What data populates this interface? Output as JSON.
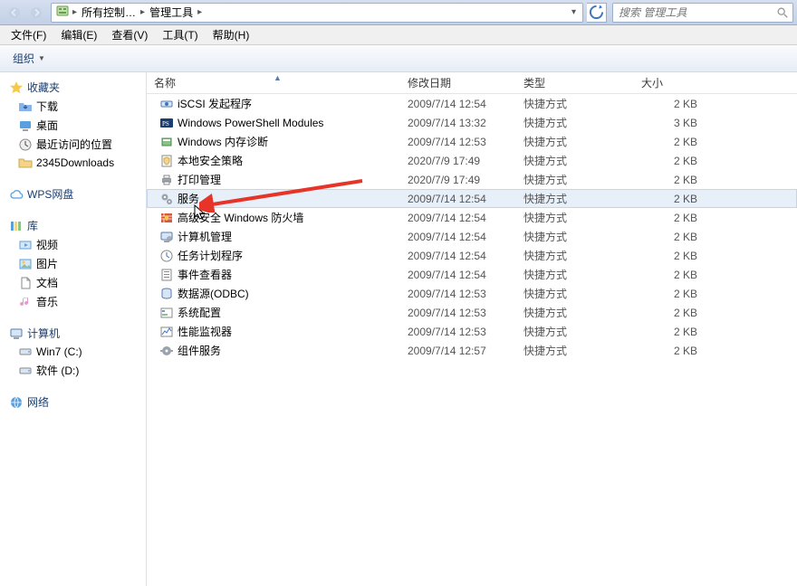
{
  "nav": {
    "breadcrumb": [
      "所有控制…",
      "管理工具"
    ],
    "search_placeholder": "搜索 管理工具"
  },
  "menu": {
    "file": "文件(F)",
    "edit": "编辑(E)",
    "view": "查看(V)",
    "tools": "工具(T)",
    "help": "帮助(H)"
  },
  "toolbar": {
    "organize": "组织"
  },
  "sidebar": {
    "favorites": {
      "title": "收藏夹",
      "items": [
        "下载",
        "桌面",
        "最近访问的位置",
        "2345Downloads"
      ]
    },
    "wps": {
      "title": "WPS网盘"
    },
    "libraries": {
      "title": "库",
      "items": [
        "视频",
        "图片",
        "文档",
        "音乐"
      ]
    },
    "computer": {
      "title": "计算机",
      "items": [
        "Win7 (C:)",
        "软件 (D:)"
      ]
    },
    "network": {
      "title": "网络"
    }
  },
  "columns": {
    "name": "名称",
    "date": "修改日期",
    "type": "类型",
    "size": "大小"
  },
  "files": [
    {
      "name": "iSCSI 发起程序",
      "date": "2009/7/14 12:54",
      "type": "快捷方式",
      "size": "2 KB",
      "icon": "iscsi"
    },
    {
      "name": "Windows PowerShell Modules",
      "date": "2009/7/14 13:32",
      "type": "快捷方式",
      "size": "3 KB",
      "icon": "ps"
    },
    {
      "name": "Windows 内存诊断",
      "date": "2009/7/14 12:53",
      "type": "快捷方式",
      "size": "2 KB",
      "icon": "mem"
    },
    {
      "name": "本地安全策略",
      "date": "2020/7/9 17:49",
      "type": "快捷方式",
      "size": "2 KB",
      "icon": "secpol"
    },
    {
      "name": "打印管理",
      "date": "2020/7/9 17:49",
      "type": "快捷方式",
      "size": "2 KB",
      "icon": "print"
    },
    {
      "name": "服务",
      "date": "2009/7/14 12:54",
      "type": "快捷方式",
      "size": "2 KB",
      "icon": "services",
      "selected": true
    },
    {
      "name": "高级安全 Windows 防火墙",
      "date": "2009/7/14 12:54",
      "type": "快捷方式",
      "size": "2 KB",
      "icon": "firewall"
    },
    {
      "name": "计算机管理",
      "date": "2009/7/14 12:54",
      "type": "快捷方式",
      "size": "2 KB",
      "icon": "compmgmt"
    },
    {
      "name": "任务计划程序",
      "date": "2009/7/14 12:54",
      "type": "快捷方式",
      "size": "2 KB",
      "icon": "tasksched"
    },
    {
      "name": "事件查看器",
      "date": "2009/7/14 12:54",
      "type": "快捷方式",
      "size": "2 KB",
      "icon": "eventvwr"
    },
    {
      "name": "数据源(ODBC)",
      "date": "2009/7/14 12:53",
      "type": "快捷方式",
      "size": "2 KB",
      "icon": "odbc"
    },
    {
      "name": "系统配置",
      "date": "2009/7/14 12:53",
      "type": "快捷方式",
      "size": "2 KB",
      "icon": "msconfig"
    },
    {
      "name": "性能监视器",
      "date": "2009/7/14 12:53",
      "type": "快捷方式",
      "size": "2 KB",
      "icon": "perfmon"
    },
    {
      "name": "组件服务",
      "date": "2009/7/14 12:57",
      "type": "快捷方式",
      "size": "2 KB",
      "icon": "comsvcs"
    }
  ]
}
